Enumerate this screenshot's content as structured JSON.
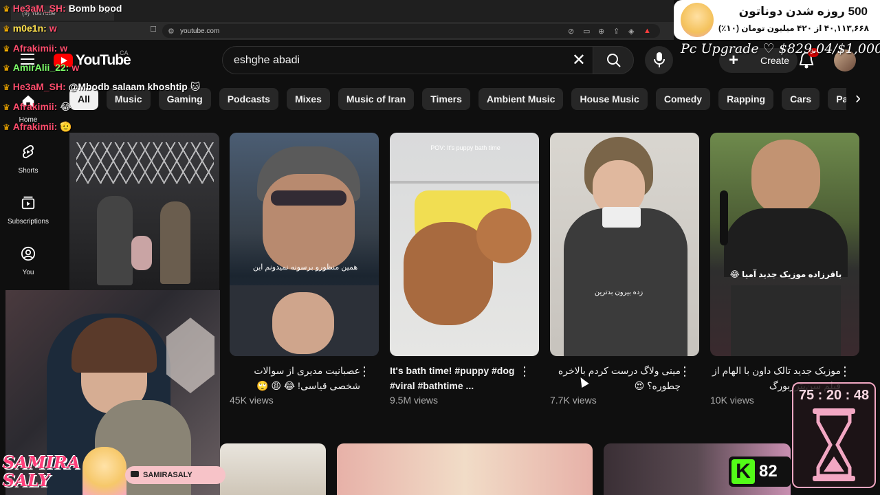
{
  "browser": {
    "tab_title": "(9) YouTube",
    "url": "youtube.com"
  },
  "header": {
    "logo": "YouTube",
    "country": "CA",
    "search_query": "eshghe abadi",
    "create_label": "Create",
    "notif_count": "9+"
  },
  "chips": [
    "All",
    "Music",
    "Gaming",
    "Podcasts",
    "Mixes",
    "Music of Iran",
    "Timers",
    "Ambient Music",
    "House Music",
    "Comedy",
    "Rapping",
    "Cars",
    "Pain"
  ],
  "sidebar": {
    "items": [
      {
        "label": "Home",
        "icon": "home-icon"
      },
      {
        "label": "Shorts",
        "icon": "shorts-icon"
      },
      {
        "label": "Subscriptions",
        "icon": "subscriptions-icon"
      },
      {
        "label": "You",
        "icon": "you-icon"
      }
    ]
  },
  "videos": [
    {
      "title": "عصبانیت مدیری از سوالات شخصی قیاسی! 😂 😩 🙄",
      "views": "45K views",
      "rtl": true,
      "overlay": "همین منظورو برسونه نمیدونم این"
    },
    {
      "title": "It's bath time! #puppy #dog #viral #bathtime ...",
      "views": "9.5M views",
      "rtl": false,
      "overlay": "POV: It's puppy bath time"
    },
    {
      "title": "مینی ولاگ درست کردم بالاخره چطوره؟ 😍",
      "views": "7.7K views",
      "rtl": true,
      "overlay": "زده بیرون بدترین"
    },
    {
      "title": "موزیک جدید تالک داون با الهام از فیلم سن‌پترزبورگ",
      "views": "10K views",
      "rtl": true,
      "overlay": "باقرزاده موزیک جدید آمیا 😂"
    }
  ],
  "chat": [
    {
      "user": "He3aM_SH:",
      "msg": "Bomb bood",
      "color": "#ff4d6d"
    },
    {
      "user": "m0e1n:",
      "msg": "w",
      "color": "#ffe14d"
    },
    {
      "user": "Afrakimii:",
      "msg": "w",
      "color": "#ff4d6d"
    },
    {
      "user": "AmirAlii_22:",
      "msg": "w",
      "color": "#7dff6a"
    },
    {
      "user": "He3aM_SH:",
      "msg": "@Mbodb salaam khoshtip 🐱",
      "color": "#ff4d6d"
    },
    {
      "user": "Afrakimii:",
      "msg": "😂",
      "color": "#ff4d6d"
    },
    {
      "user": "Afrakimii:",
      "msg": "🫡",
      "color": "#ff4d6d"
    }
  ],
  "donation": {
    "title": "500 روزه شدن دوناتون",
    "subtitle": "۴۰,۱۱۳,۶۶۸ از ۴۲۰ میلیون تومان (۱۰٪)"
  },
  "upgrade_goal": "Pc Upgrade ♡ $829.04/$1,000",
  "streamer": {
    "name_line1": "SAMIRA",
    "name_line2": "SALY",
    "social": "SAMIRASALY"
  },
  "timer": "75 : 20 : 48",
  "viewers": "82"
}
